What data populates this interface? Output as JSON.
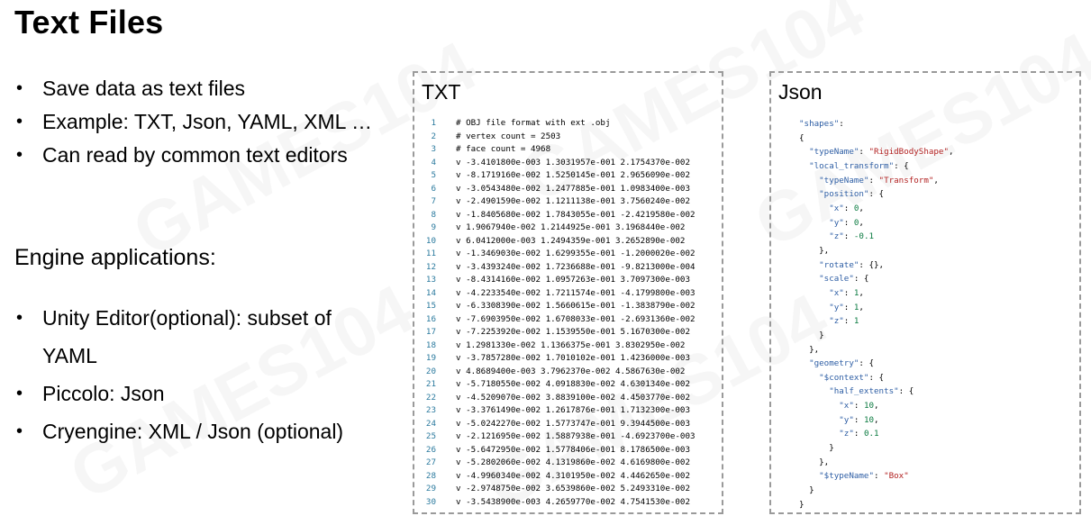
{
  "slide": {
    "title": "Text Files",
    "bullets_top": [
      "Save data as text files",
      "Example: TXT, Json, YAML, XML …",
      "Can read by common text editors"
    ],
    "subhead": "Engine applications:",
    "bullets_bottom": [
      "Unity Editor(optional): subset of",
      "YAML",
      "Piccolo: Json",
      "Cryengine: XML / Json (optional)"
    ]
  },
  "txt_panel": {
    "title": "TXT",
    "lines": [
      {
        "n": "1",
        "text": "# OBJ file format with ext .obj"
      },
      {
        "n": "2",
        "text": "# vertex count = 2503"
      },
      {
        "n": "3",
        "text": "# face count = 4968"
      },
      {
        "n": "4",
        "text": "v -3.4101800e-003 1.3031957e-001 2.1754370e-002"
      },
      {
        "n": "5",
        "text": "v -8.1719160e-002 1.5250145e-001 2.9656090e-002"
      },
      {
        "n": "6",
        "text": "v -3.0543480e-002 1.2477885e-001 1.0983400e-003"
      },
      {
        "n": "7",
        "text": "v -2.4901590e-002 1.1211138e-001 3.7560240e-002"
      },
      {
        "n": "8",
        "text": "v -1.8405680e-002 1.7843055e-001 -2.4219580e-002"
      },
      {
        "n": "9",
        "text": "v 1.9067940e-002 1.2144925e-001 3.1968440e-002"
      },
      {
        "n": "10",
        "text": "v 6.0412000e-003 1.2494359e-001 3.2652890e-002"
      },
      {
        "n": "11",
        "text": "v -1.3469030e-002 1.6299355e-001 -1.2000020e-002"
      },
      {
        "n": "12",
        "text": "v -3.4393240e-002 1.7236688e-001 -9.8213000e-004"
      },
      {
        "n": "13",
        "text": "v -8.4314160e-002 1.0957263e-001 3.7097300e-003"
      },
      {
        "n": "14",
        "text": "v -4.2233540e-002 1.7211574e-001 -4.1799800e-003"
      },
      {
        "n": "15",
        "text": "v -6.3308390e-002 1.5660615e-001 -1.3838790e-002"
      },
      {
        "n": "16",
        "text": "v -7.6903950e-002 1.6708033e-001 -2.6931360e-002"
      },
      {
        "n": "17",
        "text": "v -7.2253920e-002 1.1539550e-001 5.1670300e-002"
      },
      {
        "n": "18",
        "text": "v 1.2981330e-002 1.1366375e-001 3.8302950e-002"
      },
      {
        "n": "19",
        "text": "v -3.7857280e-002 1.7010102e-001 1.4236000e-003"
      },
      {
        "n": "20",
        "text": "v 4.8689400e-003 3.7962370e-002 4.5867630e-002"
      },
      {
        "n": "21",
        "text": "v -5.7180550e-002 4.0918830e-002 4.6301340e-002"
      },
      {
        "n": "22",
        "text": "v -4.5209070e-002 3.8839100e-002 4.4503770e-002"
      },
      {
        "n": "23",
        "text": "v -3.3761490e-002 1.2617876e-001 1.7132300e-003"
      },
      {
        "n": "24",
        "text": "v -5.0242270e-002 1.5773747e-001 9.3944500e-003"
      },
      {
        "n": "25",
        "text": "v -2.1216950e-002 1.5887938e-001 -4.6923700e-003"
      },
      {
        "n": "26",
        "text": "v -5.6472950e-002 1.5778406e-001 8.1786500e-003"
      },
      {
        "n": "27",
        "text": "v -5.2802060e-002 4.1319860e-002 4.6169800e-002"
      },
      {
        "n": "28",
        "text": "v -4.9960340e-002 4.3101950e-002 4.4462650e-002"
      },
      {
        "n": "29",
        "text": "v -2.9748750e-002 3.6539860e-002 5.2493310e-002"
      },
      {
        "n": "30",
        "text": "v -3.5438900e-003 4.2659770e-002 4.7541530e-002"
      }
    ]
  },
  "json_panel": {
    "title": "Json",
    "lines": [
      [
        {
          "t": "\"shapes\"",
          "c": "key"
        },
        {
          "t": ":",
          "c": "pun"
        }
      ],
      [
        {
          "t": "{",
          "c": "pun"
        }
      ],
      [
        {
          "t": "  \"typeName\"",
          "c": "key"
        },
        {
          "t": ": ",
          "c": "pun"
        },
        {
          "t": "\"RigidBodyShape\"",
          "c": "str"
        },
        {
          "t": ",",
          "c": "pun"
        }
      ],
      [
        {
          "t": "  \"local_transform\"",
          "c": "key"
        },
        {
          "t": ": {",
          "c": "pun"
        }
      ],
      [
        {
          "t": "    \"typeName\"",
          "c": "key"
        },
        {
          "t": ": ",
          "c": "pun"
        },
        {
          "t": "\"Transform\"",
          "c": "str"
        },
        {
          "t": ",",
          "c": "pun"
        }
      ],
      [
        {
          "t": "    \"position\"",
          "c": "key"
        },
        {
          "t": ": {",
          "c": "pun"
        }
      ],
      [
        {
          "t": "      \"x\"",
          "c": "key"
        },
        {
          "t": ": ",
          "c": "pun"
        },
        {
          "t": "0",
          "c": "num"
        },
        {
          "t": ",",
          "c": "pun"
        }
      ],
      [
        {
          "t": "      \"y\"",
          "c": "key"
        },
        {
          "t": ": ",
          "c": "pun"
        },
        {
          "t": "0",
          "c": "num"
        },
        {
          "t": ",",
          "c": "pun"
        }
      ],
      [
        {
          "t": "      \"z\"",
          "c": "key"
        },
        {
          "t": ": ",
          "c": "pun"
        },
        {
          "t": "-0.1",
          "c": "num"
        }
      ],
      [
        {
          "t": "    },",
          "c": "pun"
        }
      ],
      [
        {
          "t": "    \"rotate\"",
          "c": "key"
        },
        {
          "t": ": {},",
          "c": "pun"
        }
      ],
      [
        {
          "t": "    \"scale\"",
          "c": "key"
        },
        {
          "t": ": {",
          "c": "pun"
        }
      ],
      [
        {
          "t": "      \"x\"",
          "c": "key"
        },
        {
          "t": ": ",
          "c": "pun"
        },
        {
          "t": "1",
          "c": "num"
        },
        {
          "t": ",",
          "c": "pun"
        }
      ],
      [
        {
          "t": "      \"y\"",
          "c": "key"
        },
        {
          "t": ": ",
          "c": "pun"
        },
        {
          "t": "1",
          "c": "num"
        },
        {
          "t": ",",
          "c": "pun"
        }
      ],
      [
        {
          "t": "      \"z\"",
          "c": "key"
        },
        {
          "t": ": ",
          "c": "pun"
        },
        {
          "t": "1",
          "c": "num"
        }
      ],
      [
        {
          "t": "    }",
          "c": "pun"
        }
      ],
      [
        {
          "t": "  },",
          "c": "pun"
        }
      ],
      [
        {
          "t": "  \"geometry\"",
          "c": "key"
        },
        {
          "t": ": {",
          "c": "pun"
        }
      ],
      [
        {
          "t": "    \"$context\"",
          "c": "key"
        },
        {
          "t": ": {",
          "c": "pun"
        }
      ],
      [
        {
          "t": "      \"half_extents\"",
          "c": "key"
        },
        {
          "t": ": {",
          "c": "pun"
        }
      ],
      [
        {
          "t": "        \"x\"",
          "c": "key"
        },
        {
          "t": ": ",
          "c": "pun"
        },
        {
          "t": "10",
          "c": "num"
        },
        {
          "t": ",",
          "c": "pun"
        }
      ],
      [
        {
          "t": "        \"y\"",
          "c": "key"
        },
        {
          "t": ": ",
          "c": "pun"
        },
        {
          "t": "10",
          "c": "num"
        },
        {
          "t": ",",
          "c": "pun"
        }
      ],
      [
        {
          "t": "        \"z\"",
          "c": "key"
        },
        {
          "t": ": ",
          "c": "pun"
        },
        {
          "t": "0.1",
          "c": "num"
        }
      ],
      [
        {
          "t": "      }",
          "c": "pun"
        }
      ],
      [
        {
          "t": "    },",
          "c": "pun"
        }
      ],
      [
        {
          "t": "    \"$typeName\"",
          "c": "key"
        },
        {
          "t": ": ",
          "c": "pun"
        },
        {
          "t": "\"Box\"",
          "c": "str"
        }
      ],
      [
        {
          "t": "  }",
          "c": "pun"
        }
      ],
      [
        {
          "t": "}",
          "c": "pun"
        }
      ]
    ]
  },
  "watermark": {
    "texts": [
      "GAMES104",
      "GAMES104",
      "GAMES104",
      "GAMES104",
      "GAMES104"
    ],
    "color": "#000000"
  }
}
